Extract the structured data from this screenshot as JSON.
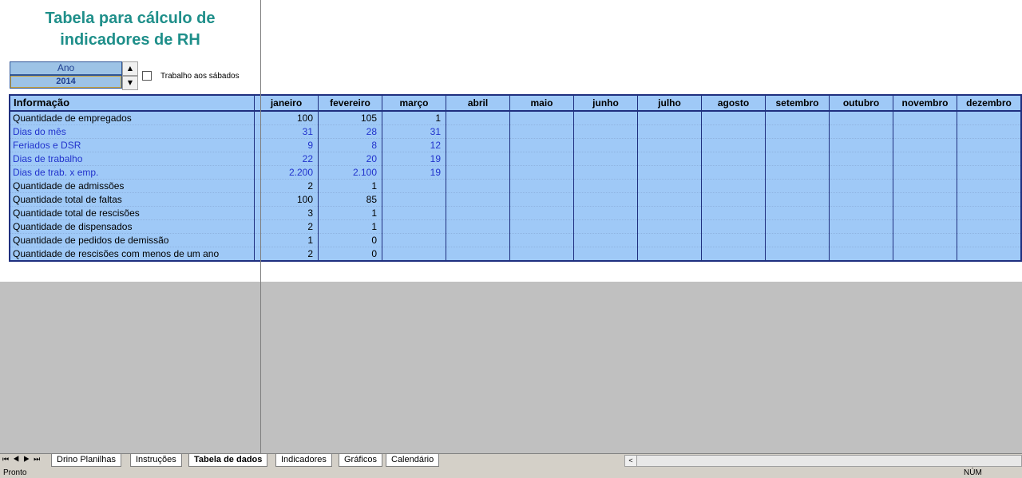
{
  "title_line1": "Tabela para cálculo de",
  "title_line2": "indicadores de RH",
  "year_label": "Ano",
  "year_value": "2014",
  "saturday_checkbox_label": "Trabalho aos sábados",
  "saturday_checked": false,
  "table": {
    "header_info": "Informação",
    "months": [
      "janeiro",
      "fevereiro",
      "março",
      "abril",
      "maio",
      "junho",
      "julho",
      "agosto",
      "setembro",
      "outubro",
      "novembro",
      "dezembro"
    ],
    "rows": [
      {
        "label": "Quantidade de empregados",
        "color": "black",
        "values": [
          "100",
          "105",
          "1",
          "",
          "",
          "",
          "",
          "",
          "",
          "",
          "",
          ""
        ]
      },
      {
        "label": "Dias do mês",
        "color": "blue",
        "values": [
          "31",
          "28",
          "31",
          "",
          "",
          "",
          "",
          "",
          "",
          "",
          "",
          ""
        ]
      },
      {
        "label": "Feriados e DSR",
        "color": "blue",
        "values": [
          "9",
          "8",
          "12",
          "",
          "",
          "",
          "",
          "",
          "",
          "",
          "",
          ""
        ]
      },
      {
        "label": "Dias de trabalho",
        "color": "blue",
        "values": [
          "22",
          "20",
          "19",
          "",
          "",
          "",
          "",
          "",
          "",
          "",
          "",
          ""
        ]
      },
      {
        "label": "Dias de trab. x emp.",
        "color": "blue",
        "values": [
          "2.200",
          "2.100",
          "19",
          "",
          "",
          "",
          "",
          "",
          "",
          "",
          "",
          ""
        ]
      },
      {
        "label": "Quantidade de admissões",
        "color": "black",
        "values": [
          "2",
          "1",
          "",
          "",
          "",
          "",
          "",
          "",
          "",
          "",
          "",
          ""
        ]
      },
      {
        "label": "Quantidade total de faltas",
        "color": "black",
        "values": [
          "100",
          "85",
          "",
          "",
          "",
          "",
          "",
          "",
          "",
          "",
          "",
          ""
        ]
      },
      {
        "label": "Quantidade total de rescisões",
        "color": "black",
        "values": [
          "3",
          "1",
          "",
          "",
          "",
          "",
          "",
          "",
          "",
          "",
          "",
          ""
        ]
      },
      {
        "label": "Quantidade de dispensados",
        "color": "black",
        "values": [
          "2",
          "1",
          "",
          "",
          "",
          "",
          "",
          "",
          "",
          "",
          "",
          ""
        ]
      },
      {
        "label": "Quantidade de pedidos de demissão",
        "color": "black",
        "values": [
          "1",
          "0",
          "",
          "",
          "",
          "",
          "",
          "",
          "",
          "",
          "",
          ""
        ]
      },
      {
        "label": "Quantidade de rescisões com menos de um ano",
        "color": "black",
        "values": [
          "2",
          "0",
          "",
          "",
          "",
          "",
          "",
          "",
          "",
          "",
          "",
          ""
        ]
      }
    ]
  },
  "tabs": [
    {
      "label": "Drino Planilhas",
      "active": false
    },
    {
      "label": "Instruções",
      "active": false
    },
    {
      "label": "Tabela de dados",
      "active": true
    },
    {
      "label": "Indicadores",
      "active": false
    },
    {
      "label": "Gráficos",
      "active": false
    },
    {
      "label": "Calendário",
      "active": false
    }
  ],
  "status_left": "Pronto",
  "status_right": "NÚM",
  "colors": {
    "table_fill": "#9fc9f7",
    "title": "#1f8f8a",
    "border": "#1f2f7f",
    "blue_text": "#2233cc"
  }
}
